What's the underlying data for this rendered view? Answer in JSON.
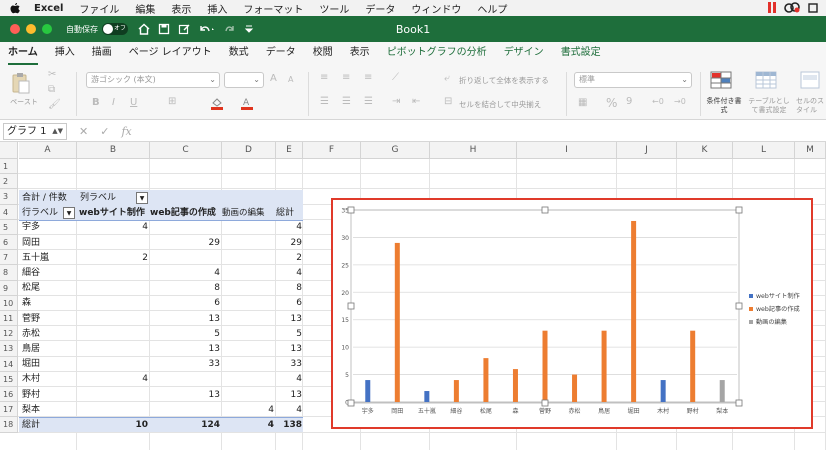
{
  "menubar": {
    "app": "Excel",
    "items": [
      "ファイル",
      "編集",
      "表示",
      "挿入",
      "フォーマット",
      "ツール",
      "データ",
      "ウィンドウ",
      "ヘルプ"
    ]
  },
  "titlebar": {
    "autosave_label": "自動保存",
    "autosave_state": "オフ",
    "document_title": "Book1"
  },
  "ribbon_tabs": [
    "ホーム",
    "挿入",
    "描画",
    "ページ レイアウト",
    "数式",
    "データ",
    "校閲",
    "表示",
    "ピボットグラフの分析",
    "デザイン",
    "書式設定"
  ],
  "ribbon": {
    "paste_label": "ペースト",
    "font_name": "游ゴシック (本文)",
    "wrap_text": "折り返して全体を表示する",
    "merge_center": "セルを結合して中央揃え",
    "number_format": "標準",
    "conditional_format": "条件付き書式",
    "table_format": "テーブルとして書式設定",
    "cell_style": "セルのスタイル"
  },
  "formula_bar": {
    "name_box": "グラフ 1",
    "fx_label": "fx"
  },
  "columns": [
    "A",
    "B",
    "C",
    "D",
    "E",
    "F",
    "G",
    "H",
    "I",
    "J",
    "K",
    "L",
    "M"
  ],
  "rows": [
    "1",
    "2",
    "3",
    "4",
    "5",
    "6",
    "7",
    "8",
    "9",
    "10",
    "11",
    "12",
    "13",
    "14",
    "15",
    "16",
    "17",
    "18"
  ],
  "pivot": {
    "row3_a": "合計 / 件数",
    "row3_b": "列ラベル",
    "row_label_header": "行ラベル",
    "headers": [
      "webサイト制作",
      "web記事の作成",
      "動画の編集",
      "総計"
    ],
    "rows": [
      {
        "label": "宇多",
        "b": "4",
        "c": "",
        "d": "",
        "e": "4"
      },
      {
        "label": "岡田",
        "b": "",
        "c": "29",
        "d": "",
        "e": "29"
      },
      {
        "label": "五十嵐",
        "b": "2",
        "c": "",
        "d": "",
        "e": "2"
      },
      {
        "label": "細谷",
        "b": "",
        "c": "4",
        "d": "",
        "e": "4"
      },
      {
        "label": "松尾",
        "b": "",
        "c": "8",
        "d": "",
        "e": "8"
      },
      {
        "label": "森",
        "b": "",
        "c": "6",
        "d": "",
        "e": "6"
      },
      {
        "label": "菅野",
        "b": "",
        "c": "13",
        "d": "",
        "e": "13"
      },
      {
        "label": "赤松",
        "b": "",
        "c": "5",
        "d": "",
        "e": "5"
      },
      {
        "label": "鳥居",
        "b": "",
        "c": "13",
        "d": "",
        "e": "13"
      },
      {
        "label": "堀田",
        "b": "",
        "c": "33",
        "d": "",
        "e": "33"
      },
      {
        "label": "木村",
        "b": "4",
        "c": "",
        "d": "",
        "e": "4"
      },
      {
        "label": "野村",
        "b": "",
        "c": "13",
        "d": "",
        "e": "13"
      },
      {
        "label": "梨本",
        "b": "",
        "c": "",
        "d": "4",
        "e": "4"
      }
    ],
    "total": {
      "label": "総計",
      "b": "10",
      "c": "124",
      "d": "4",
      "e": "138"
    }
  },
  "chart_data": {
    "type": "bar",
    "categories": [
      "宇多",
      "岡田",
      "五十嵐",
      "細谷",
      "松尾",
      "森",
      "菅野",
      "赤松",
      "鳥居",
      "堀田",
      "木村",
      "野村",
      "梨本"
    ],
    "series": [
      {
        "name": "webサイト制作",
        "color": "#4472c4",
        "values": [
          4,
          0,
          2,
          0,
          0,
          0,
          0,
          0,
          0,
          0,
          4,
          0,
          0
        ]
      },
      {
        "name": "web記事の作成",
        "color": "#ed7d31",
        "values": [
          0,
          29,
          0,
          4,
          8,
          6,
          13,
          5,
          13,
          33,
          0,
          13,
          0
        ]
      },
      {
        "name": "動画の編集",
        "color": "#a5a5a5",
        "values": [
          0,
          0,
          0,
          0,
          0,
          0,
          0,
          0,
          0,
          0,
          0,
          0,
          4
        ]
      }
    ],
    "yticks": [
      "0",
      "5",
      "10",
      "15",
      "20",
      "25",
      "30",
      "35"
    ],
    "ylim": [
      0,
      35
    ],
    "grid": true,
    "legend_position": "right"
  }
}
